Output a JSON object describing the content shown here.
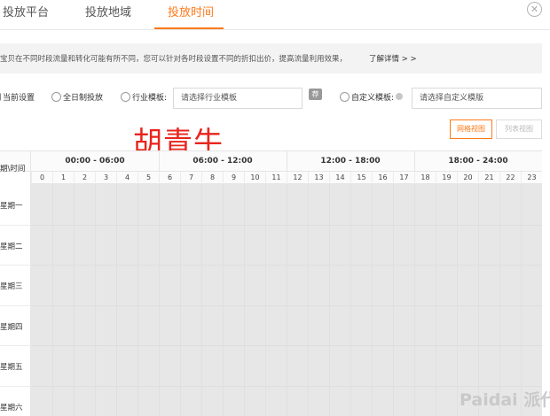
{
  "tabs": [
    {
      "label": "投放平台",
      "active": false
    },
    {
      "label": "投放地域",
      "active": false
    },
    {
      "label": "投放时间",
      "active": true
    }
  ],
  "close_icon": "close-circle-icon",
  "notice": {
    "text": "宝贝在不同时段流量和转化可能有所不同，您可以针对各时段设置不同的折扣出价，提高流量利用效果，",
    "link": "了解详情 > >"
  },
  "options": {
    "current": "当前设置",
    "allday": "全日制投放",
    "industry": "行业模板:",
    "industry_placeholder": "请选择行业模板",
    "tag_icon": "荐",
    "custom": "自定义模板:",
    "custom_placeholder": "请选择自定义模版"
  },
  "watermark": "胡青牛",
  "view_toggle": {
    "grid": "网格视图",
    "list": "列表视图"
  },
  "grid": {
    "corner": "期\\时间",
    "ranges": [
      "00:00 - 06:00",
      "06:00 - 12:00",
      "12:00 - 18:00",
      "18:00 - 24:00"
    ],
    "hours": [
      "0",
      "1",
      "2",
      "3",
      "4",
      "5",
      "6",
      "7",
      "8",
      "9",
      "10",
      "11",
      "12",
      "13",
      "14",
      "15",
      "16",
      "17",
      "18",
      "19",
      "20",
      "21",
      "22",
      "23"
    ],
    "days": [
      "星期一",
      "星期二",
      "星期三",
      "星期四",
      "星期五",
      "星期六"
    ]
  },
  "brand": "Paidai 派代",
  "colors": {
    "accent": "#ff7a1a",
    "watermark": "#e8241c",
    "grid_fill": "#e7e7e7"
  }
}
